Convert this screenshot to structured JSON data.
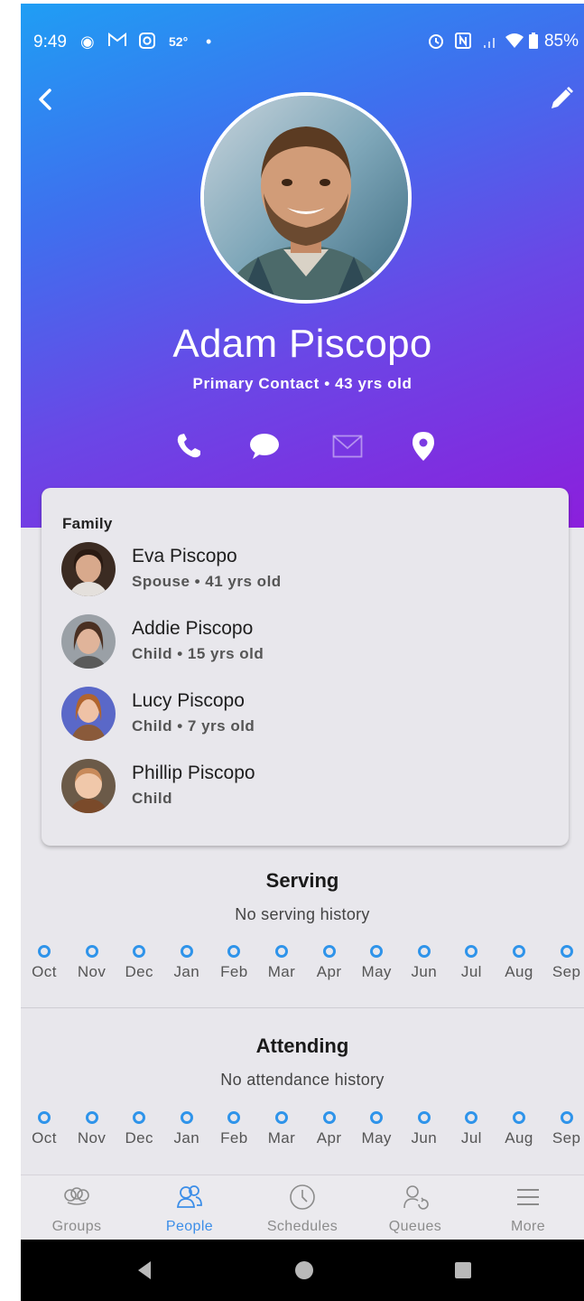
{
  "status_bar": {
    "time": "9:49",
    "temperature": "52°",
    "battery": "85%"
  },
  "profile": {
    "name": "Adam Piscopo",
    "subtitle": "Primary Contact • 43 yrs old"
  },
  "family": {
    "title": "Family",
    "members": [
      {
        "name": "Eva Piscopo",
        "role": "Spouse • 41 yrs old"
      },
      {
        "name": "Addie Piscopo",
        "role": "Child • 15 yrs old"
      },
      {
        "name": "Lucy Piscopo",
        "role": "Child • 7 yrs old"
      },
      {
        "name": "Phillip Piscopo",
        "role": "Child"
      }
    ]
  },
  "serving": {
    "title": "Serving",
    "empty_text": "No serving history",
    "months": [
      "Oct",
      "Nov",
      "Dec",
      "Jan",
      "Feb",
      "Mar",
      "Apr",
      "May",
      "Jun",
      "Jul",
      "Aug",
      "Sep"
    ]
  },
  "attending": {
    "title": "Attending",
    "empty_text": "No attendance history",
    "months": [
      "Oct",
      "Nov",
      "Dec",
      "Jan",
      "Feb",
      "Mar",
      "Apr",
      "May",
      "Jun",
      "Jul",
      "Aug",
      "Sep"
    ]
  },
  "bottom_nav": {
    "items": [
      {
        "label": "Groups",
        "icon": "groups-icon"
      },
      {
        "label": "People",
        "icon": "people-icon",
        "active": true
      },
      {
        "label": "Schedules",
        "icon": "clock-icon"
      },
      {
        "label": "Queues",
        "icon": "queues-icon"
      },
      {
        "label": "More",
        "icon": "menu-icon"
      }
    ]
  },
  "colors": {
    "gradient_start": "#1f9ef4",
    "gradient_end": "#8b1fdc",
    "accent": "#2f94ea",
    "background": "#e8e7ec"
  }
}
